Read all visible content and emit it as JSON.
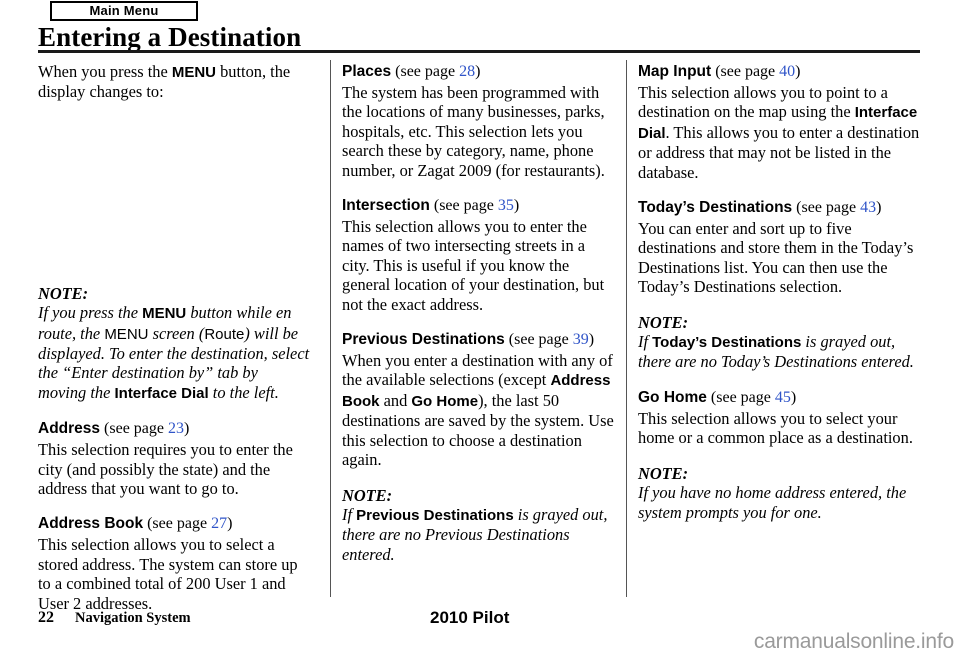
{
  "header": {
    "tab_label": "Main Menu",
    "title": "Entering a Destination"
  },
  "columns": {
    "left": {
      "intro": {
        "part1": "When you press the ",
        "menu": "MENU",
        "part2": " button, the display changes to:"
      },
      "note": {
        "label": "NOTE:",
        "t1": "If you press the ",
        "b1": "MENU",
        "t2": " button while en route, the ",
        "s1": "MENU",
        "t3": " screen (",
        "s2": "Route",
        "t4": ") will be displayed. To enter the destination, select the “Enter destination by” tab by moving the ",
        "b2": "Interface Dial",
        "t5": " to the left."
      },
      "sections": [
        {
          "heading": "Address",
          "see_page": "(see page ",
          "page": "23",
          "close": ")",
          "body": "This selection requires you to enter the city (and possibly the state) and the address that you want to go to."
        },
        {
          "heading": "Address Book",
          "see_page": "(see page ",
          "page": "27",
          "close": ")",
          "body": "This selection allows you to select a stored address. The system can store up to a combined total of 200 User 1 and User 2 addresses."
        }
      ]
    },
    "middle": {
      "sections": [
        {
          "heading": "Places",
          "see_page": "(see page ",
          "page": "28",
          "close": ")",
          "body": "The system has been programmed with the locations of many businesses, parks, hospitals, etc. This selection lets you search these by category, name, phone number, or Zagat 2009 (for restaurants)."
        },
        {
          "heading": "Intersection",
          "see_page": "(see page ",
          "page": "35",
          "close": ")",
          "body": "This selection allows you to enter the names of two intersecting streets in a city. This is useful if you know the general location of your destination, but not the exact address."
        }
      ],
      "previous": {
        "heading": "Previous Destinations",
        "see_page": "(see page ",
        "page": "39",
        "close": ")",
        "t1": "When you enter a destination with any of the available selections (except ",
        "b1": "Address Book",
        "t2": " and ",
        "b2": "Go Home",
        "t3": "), the last 50 destinations are saved by the system. Use this selection to choose a destination again."
      },
      "note": {
        "label": "NOTE:",
        "t1": "If ",
        "b1": "Previous Destinations",
        "t2": " is grayed out, there are no Previous Destinations entered."
      }
    },
    "right": {
      "map_input": {
        "heading": "Map Input",
        "see_page": "(see page ",
        "page": "40",
        "close": ")",
        "t1": "This selection allows you to point to a destination on the map using the ",
        "b1": "Interface Dial",
        "t2": ". This allows you to enter a destination or address that may not be listed in the database."
      },
      "todays": {
        "heading": "Today’s Destinations",
        "see_page": "(see page ",
        "page": "43",
        "close": ")",
        "body": "You can enter and sort up to five destinations and store them in the Today’s Destinations list. You can then use the Today’s Destinations selection."
      },
      "note1": {
        "label": "NOTE:",
        "t1": "If ",
        "b1": "Today’s Destinations",
        "t2": " is grayed out, there are no Today’s Destinations entered."
      },
      "go_home": {
        "heading": "Go Home",
        "see_page": "(see page ",
        "page": "45",
        "close": ")",
        "body": "This selection allows you to select your home or a common place as a destination."
      },
      "note2": {
        "label": "NOTE:",
        "text": "If you have no home address entered, the system prompts you for one."
      }
    }
  },
  "footer": {
    "page_number": "22",
    "section_name": "Navigation System",
    "model": "2010 Pilot",
    "watermark": "carmanualsonline.info"
  },
  "colors": {
    "page_ref_blue": "#2f54c8",
    "rule_black": "#1a1a1a",
    "divider_gray": "#555555",
    "watermark_gray": "#9a9a9a"
  }
}
